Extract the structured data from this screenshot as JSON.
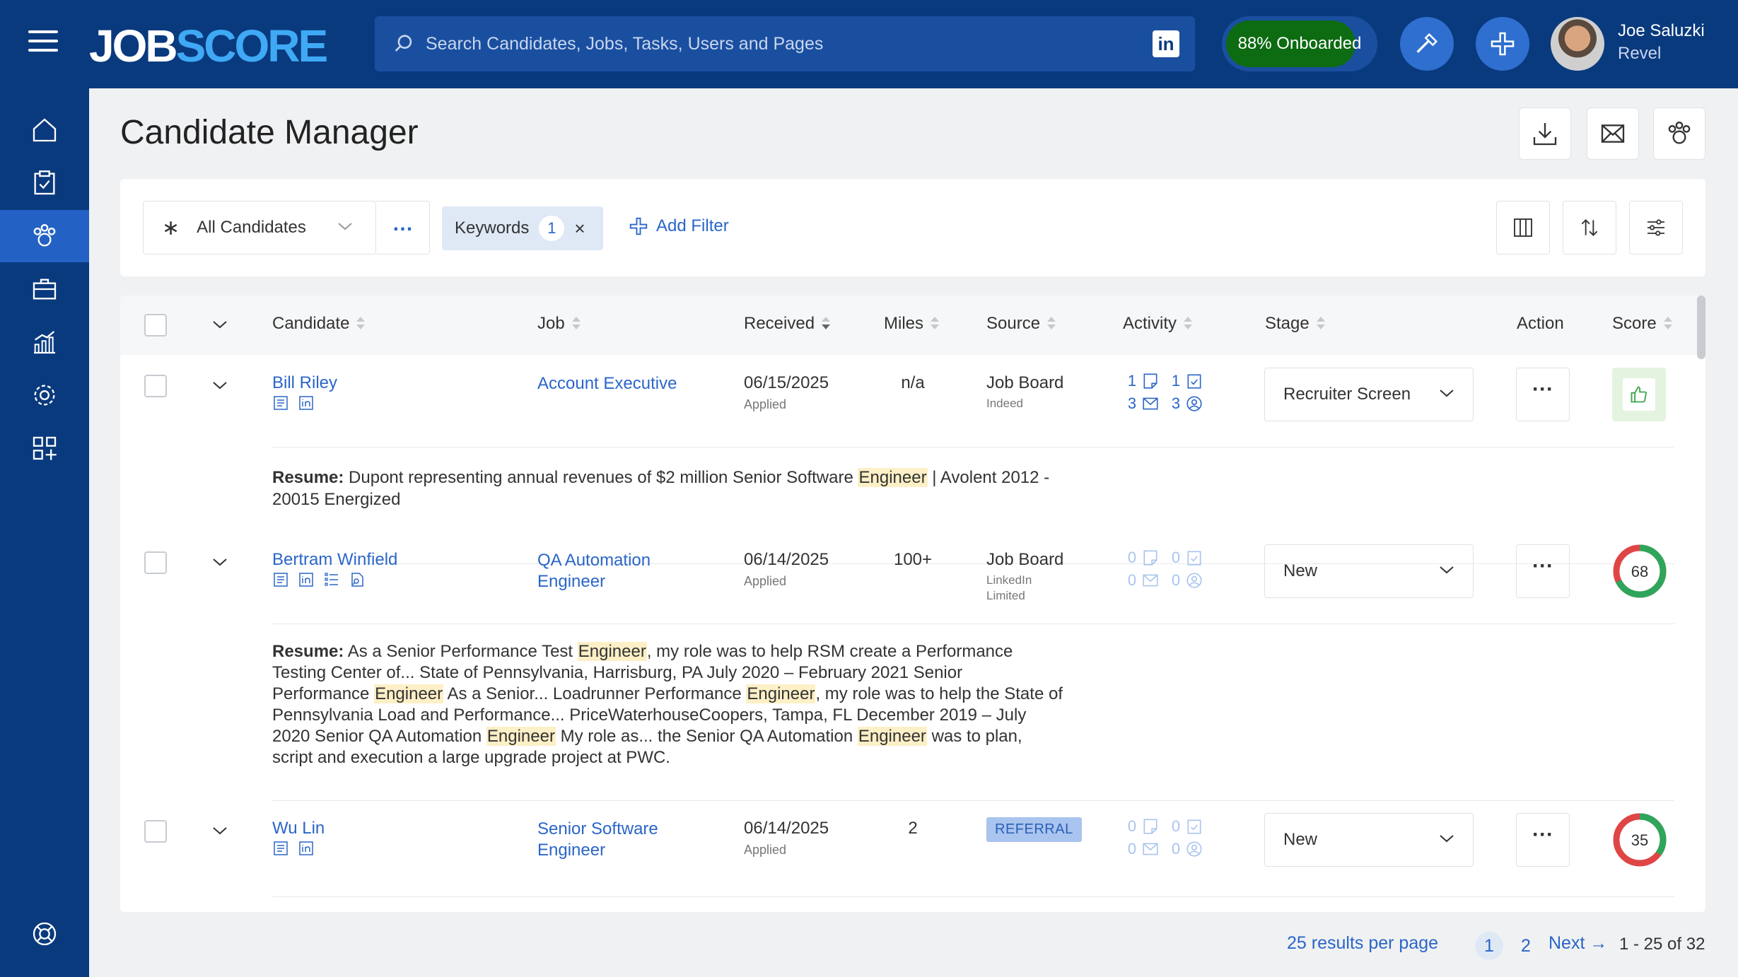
{
  "app": {
    "logo_primary": "JOB",
    "logo_secondary": "SCORE",
    "search_placeholder": "Search Candidates, Jobs, Tasks, Users and Pages",
    "linkedin_label": "in",
    "onboarded_label": "88% Onboarded",
    "onboarded_percent": 88,
    "user_name": "Joe Saluzki",
    "user_org": "Revel"
  },
  "sidebar": {
    "items": [
      {
        "icon": "home-icon"
      },
      {
        "icon": "tasks-icon"
      },
      {
        "icon": "candidates-icon",
        "active": true
      },
      {
        "icon": "jobs-icon"
      },
      {
        "icon": "reports-icon"
      },
      {
        "icon": "settings-icon"
      },
      {
        "icon": "apps-icon"
      }
    ],
    "help_icon": "help-icon"
  },
  "page": {
    "title": "Candidate Manager",
    "header_actions": [
      "download-icon",
      "email-icon",
      "candidates-icon"
    ]
  },
  "filters": {
    "view": "All Candidates",
    "more": "…",
    "chip_label": "Keywords",
    "chip_count": "1",
    "chip_close": "×",
    "add_filter": "Add Filter"
  },
  "table": {
    "columns": {
      "candidate": "Candidate",
      "job": "Job",
      "received": "Received",
      "miles": "Miles",
      "source": "Source",
      "activity": "Activity",
      "stage": "Stage",
      "action": "Action",
      "score": "Score"
    },
    "rows": [
      {
        "name": "Bill Riley",
        "job": "Account Executive",
        "received": "06/15/2025",
        "received_sub": "Applied",
        "miles": "n/a",
        "source": "Job Board",
        "source_sub": "Indeed",
        "activity": [
          "1",
          "1",
          "3",
          "3"
        ],
        "stage": "Recruiter Screen",
        "score_type": "thumbs-up",
        "resume_label": "Resume:"
      },
      {
        "name": "Bertram Winfield",
        "job": "QA Automation Engineer",
        "received": "06/14/2025",
        "received_sub": "Applied",
        "miles": "100+",
        "source": "Job Board",
        "source_sub": "LinkedIn Limited",
        "activity": [
          "0",
          "0",
          "0",
          "0"
        ],
        "stage": "New",
        "score": "68",
        "score_value": 68,
        "resume_label": "Resume:"
      },
      {
        "name": "Wu Lin",
        "job": "Senior Software Engineer",
        "received": "06/14/2025",
        "received_sub": "Applied",
        "miles": "2",
        "source_badge": "REFERRAL",
        "activity": [
          "0",
          "0",
          "0",
          "0"
        ],
        "stage": "New",
        "score": "35",
        "score_value": 35
      }
    ],
    "resume1": [
      "Dupont representing annual revenues of $2 million Senior Software ",
      "Engineer",
      " | Avolent 2012 -",
      "20015 Energized"
    ],
    "resume2": [
      "As a Senior Performance Test ",
      "Engineer",
      ", my role was to help RSM create a Performance",
      "Testing Center of... State of Pennsylvania, Harrisburg, PA July 2020 – February 2021 Senior",
      "Performance ",
      "Engineer",
      " As a Senior... Loadrunner Performance ",
      "Engineer",
      ", my role was to help the State of",
      "Pennsylvania Load and Performance... PriceWaterhouseCoopers, Tampa, FL December 2019 – July",
      "2020 Senior QA Automation ",
      "Engineer",
      " My role as... the Senior QA Automation ",
      "Engineer",
      " was to plan,",
      "script and execution a large upgrade project at PWC."
    ]
  },
  "footer": {
    "per_page": "25 results per page",
    "page1": "1",
    "page2": "2",
    "next": "Next",
    "range": "1 - 25 of 32"
  },
  "colors": {
    "brand_navy": "#0a3a7e",
    "link_blue": "#2a66c8",
    "onboard_green": "#0d6b12",
    "score_green": "#2ea55a",
    "score_red": "#e04545"
  }
}
